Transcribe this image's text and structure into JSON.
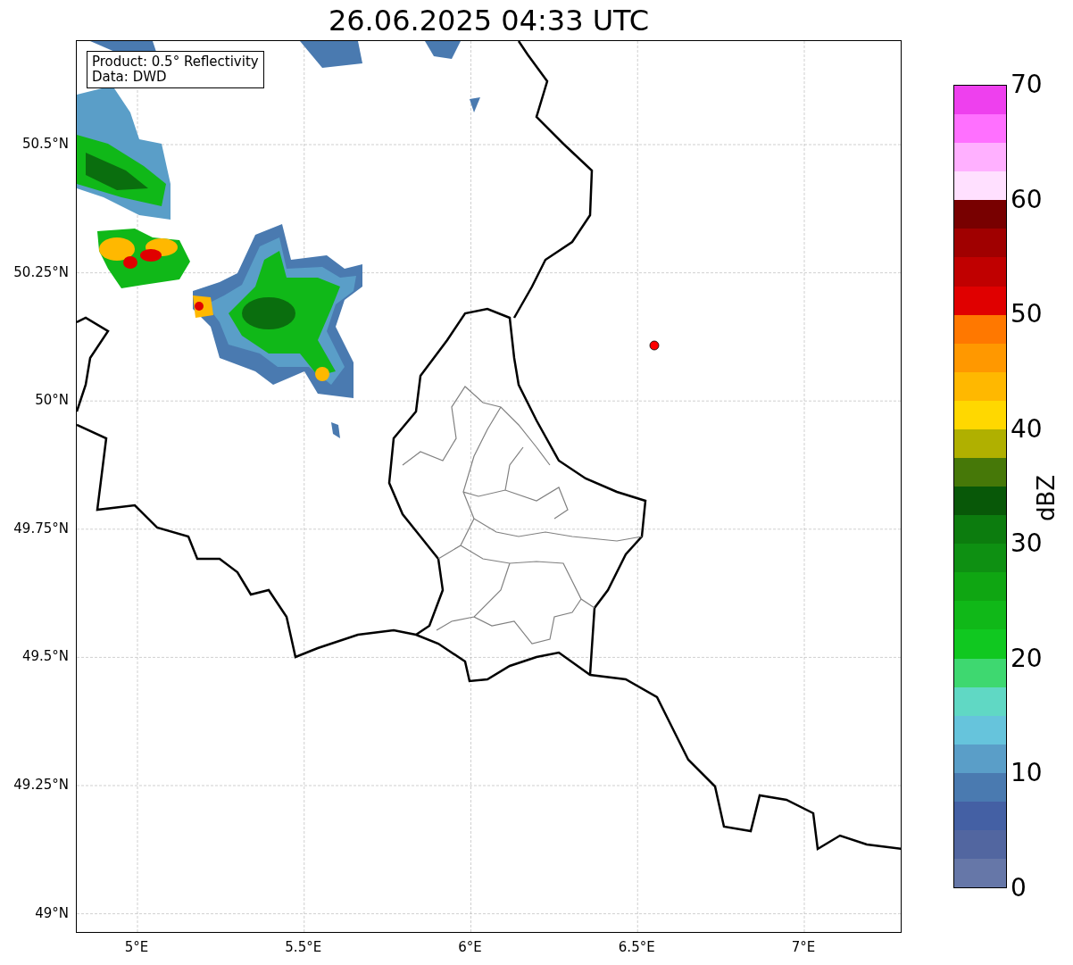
{
  "title": "26.06.2025 04:33 UTC",
  "legend_box": {
    "lines": [
      "Product: 0.5° Reflectivity",
      "Data: DWD"
    ]
  },
  "map": {
    "x_ticks": [
      "5°E",
      "5.5°E",
      "6°E",
      "6.5°E",
      "7°E"
    ],
    "y_ticks": [
      "50.5°N",
      "50.25°N",
      "50°N",
      "49.75°N",
      "49.5°N",
      "49.25°N",
      "49°N"
    ]
  },
  "colorbar": {
    "label": "dBZ",
    "ticks": [
      "70",
      "60",
      "50",
      "40",
      "30",
      "20",
      "10",
      "0"
    ],
    "segments": [
      {
        "color": "#ee40ee"
      },
      {
        "color": "#ff70ff"
      },
      {
        "color": "#ffb0ff"
      },
      {
        "color": "#ffe0ff"
      },
      {
        "color": "#780000"
      },
      {
        "color": "#a00000"
      },
      {
        "color": "#c00000"
      },
      {
        "color": "#e00000"
      },
      {
        "color": "#ff7800"
      },
      {
        "color": "#ff9800"
      },
      {
        "color": "#ffb800"
      },
      {
        "color": "#ffd800"
      },
      {
        "color": "#b0b000"
      },
      {
        "color": "#467808"
      },
      {
        "color": "#085808"
      },
      {
        "color": "#0c7c0e"
      },
      {
        "color": "#0e9012"
      },
      {
        "color": "#0fa612"
      },
      {
        "color": "#10b818"
      },
      {
        "color": "#10c820"
      },
      {
        "color": "#3ed870"
      },
      {
        "color": "#60d8c4"
      },
      {
        "color": "#66c4dc"
      },
      {
        "color": "#5a9ec8"
      },
      {
        "color": "#4a7ab0"
      },
      {
        "color": "#4460a4"
      },
      {
        "color": "#5266a0"
      },
      {
        "color": "#6677a8"
      }
    ]
  }
}
